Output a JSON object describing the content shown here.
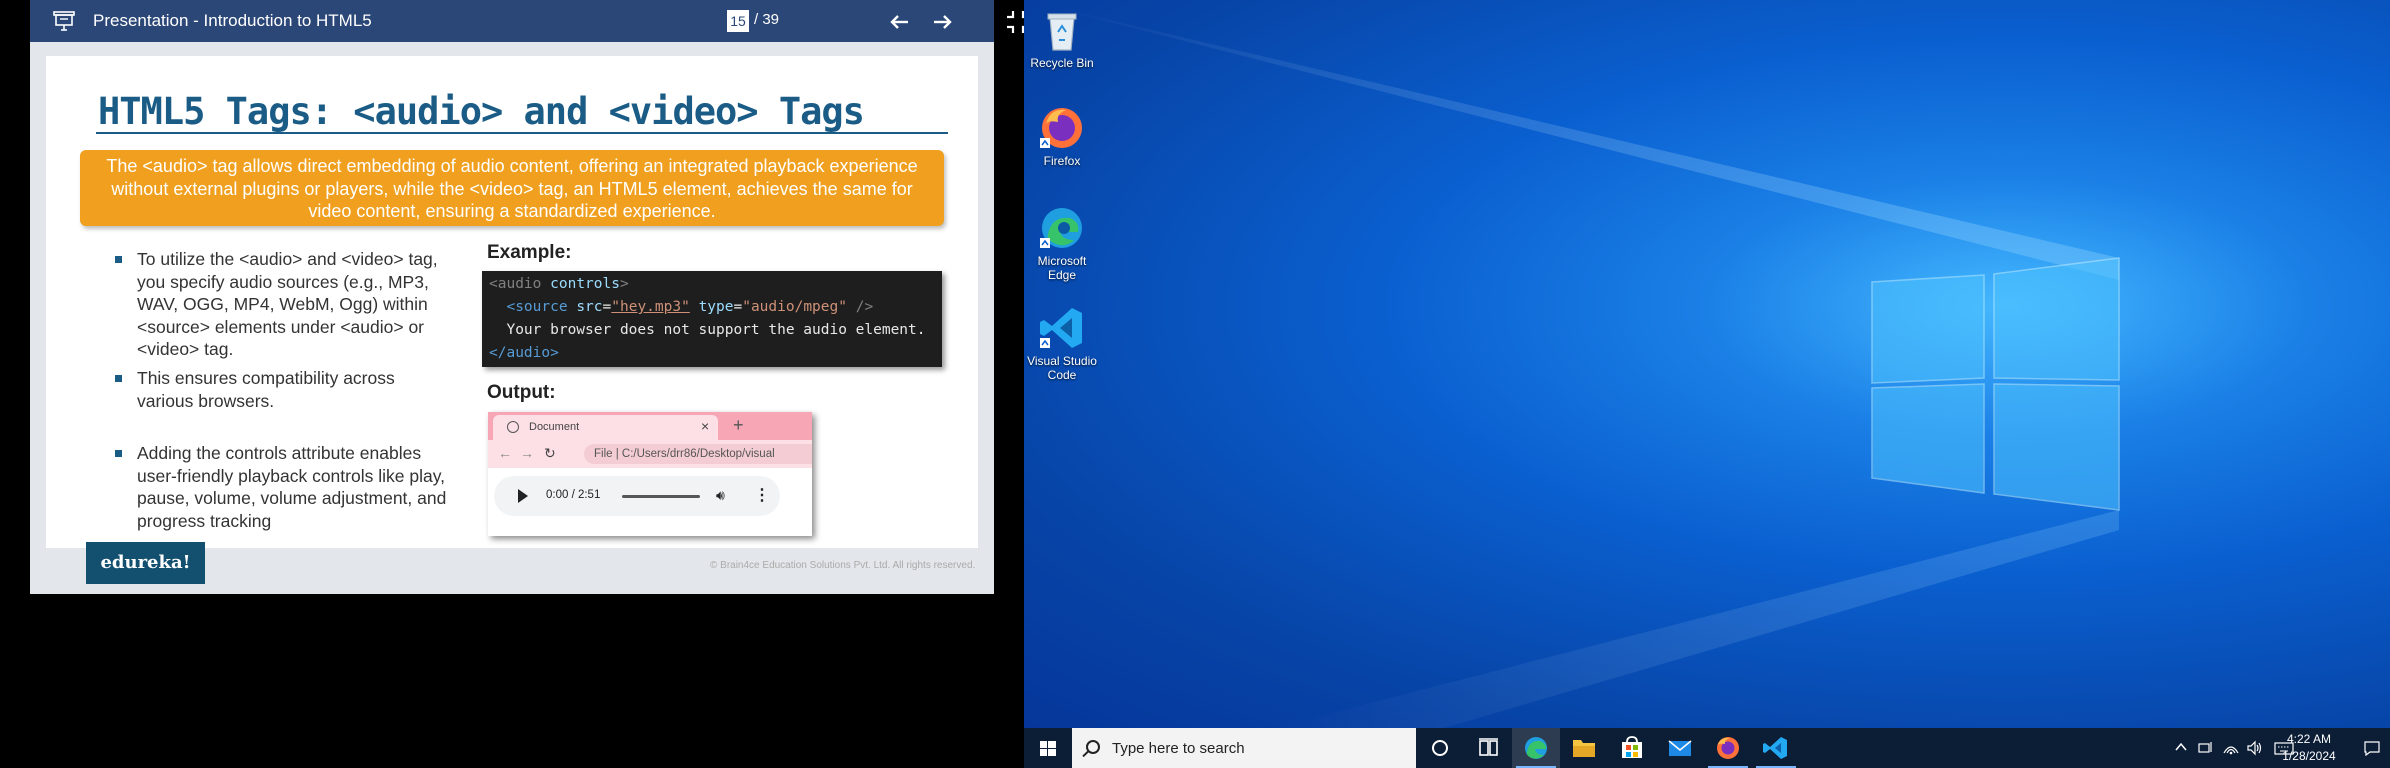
{
  "viewer": {
    "title": "Presentation - Introduction to HTML5",
    "page_current": "15",
    "page_total": "/ 39",
    "icons": [
      "presentation-icon",
      "arrow-left-icon",
      "arrow-right-icon",
      "exit-fullscreen-icon"
    ]
  },
  "slide": {
    "title": "HTML5 Tags: <audio> and <video> Tags",
    "callout": "The <audio> tag allows direct embedding of audio content, offering an integrated playback experience without external plugins or players, while the <video> tag, an HTML5 element, achieves the same for video content, ensuring a standardized experience.",
    "bullets": [
      "To utilize the <audio> and <video> tag, you specify audio sources (e.g., MP3, WAV, OGG, MP4, WebM, Ogg) within <source> elements under <audio> or <video> tag.",
      "This ensures compatibility across various browsers.",
      "Adding the controls attribute enables user-friendly playback controls like play, pause, volume, volume adjustment, and progress tracking"
    ],
    "example_label": "Example:",
    "code": {
      "l1_open": "<audio",
      "l1_attr": "controls",
      "l1_close": ">",
      "l2_open": "<source",
      "l2_attr1": "src",
      "l2_val1": "\"hey.mp3\"",
      "l2_attr2": "type",
      "l2_val2": "\"audio/mpeg\"",
      "l2_close": "/>",
      "l3_text": "Your browser does not support the audio element.",
      "l4_close": "</audio>"
    },
    "output_label": "Output:",
    "browser": {
      "tab_title": "Document",
      "tab_close": "×",
      "new_tab": "+",
      "address": "File  |  C:/Users/drr86/Desktop/visual",
      "time": "0:00 / 2:51"
    },
    "brand": "edureka!",
    "copyright": "© Brain4ce Education Solutions Pvt. Ltd. All rights reserved."
  },
  "desktop": {
    "icons": [
      {
        "label": "Recycle Bin"
      },
      {
        "label": "Firefox"
      },
      {
        "label": "Microsoft Edge"
      },
      {
        "label": "Visual Studio Code"
      }
    ]
  },
  "taskbar": {
    "search_placeholder": "Type here to search",
    "time": "4:22 AM",
    "date": "1/28/2024",
    "accent": "#0078d7"
  }
}
